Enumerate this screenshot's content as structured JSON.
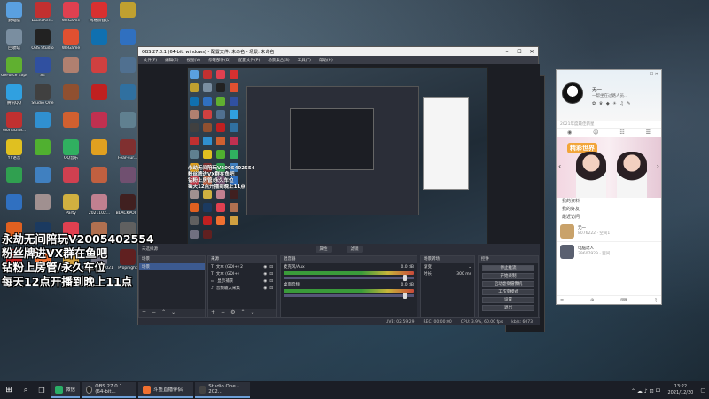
{
  "desktop": {
    "icons": [
      {
        "label": "此电脑",
        "color": "#5aa0e0"
      },
      {
        "label": "Launcher...",
        "color": "#c23030"
      },
      {
        "label": "WeGame",
        "color": "#e04050"
      },
      {
        "label": "网易云音乐",
        "color": "#d83030"
      },
      {
        "label": "",
        "color": "#c0a030"
      },
      {
        "label": "回收站",
        "color": "#7a8ea0"
      },
      {
        "label": "OBS Studio",
        "color": "#222"
      },
      {
        "label": "WeGame",
        "color": "#e05030"
      },
      {
        "label": "",
        "color": "#1070b0"
      },
      {
        "label": "",
        "color": "#3070c0"
      },
      {
        "label": "GeForce Experience",
        "color": "#60b030"
      },
      {
        "label": "SE",
        "color": "#3050a0"
      },
      {
        "label": "",
        "color": "#b08070"
      },
      {
        "label": "",
        "color": "#d04040"
      },
      {
        "label": "",
        "color": "#507090"
      },
      {
        "label": "腾讯QQ",
        "color": "#30a0e0"
      },
      {
        "label": "Studio One",
        "color": "#404040"
      },
      {
        "label": "",
        "color": "#905030"
      },
      {
        "label": "",
        "color": "#c02020"
      },
      {
        "label": "",
        "color": "#3070a0"
      },
      {
        "label": "WorldOfW...",
        "color": "#c03030"
      },
      {
        "label": "",
        "color": "#3090d0"
      },
      {
        "label": "",
        "color": "#d06030"
      },
      {
        "label": "",
        "color": "#c03050"
      },
      {
        "label": "",
        "color": "#608090"
      },
      {
        "label": "YY语音",
        "color": "#e0c020"
      },
      {
        "label": "",
        "color": "#50b030"
      },
      {
        "label": "QQ音乐",
        "color": "#30b060"
      },
      {
        "label": "",
        "color": "#e0a020"
      },
      {
        "label": "Fear-sur...",
        "color": "#803030"
      },
      {
        "label": "",
        "color": "#30a050"
      },
      {
        "label": "",
        "color": "#4080c0"
      },
      {
        "label": "",
        "color": "#d04050"
      },
      {
        "label": "",
        "color": "#c06040"
      },
      {
        "label": "",
        "color": "#705070"
      },
      {
        "label": "",
        "color": "#3070c0"
      },
      {
        "label": "",
        "color": "#a09090"
      },
      {
        "label": "Party",
        "color": "#d0b040"
      },
      {
        "label": "2021102...",
        "color": "#c08090"
      },
      {
        "label": "BLACKPOI...",
        "color": "#402020"
      },
      {
        "label": "向日葵",
        "color": "#e06020"
      },
      {
        "label": "Steam",
        "color": "#1b3a60"
      },
      {
        "label": "无畏伸缩",
        "color": "#e04050"
      },
      {
        "label": "Mahjong...",
        "color": "#b07050"
      },
      {
        "label": "",
        "color": "#606060"
      },
      {
        "label": "机箱助手",
        "color": "#c02020"
      },
      {
        "label": "斗鱼直播伴侣",
        "color": "#f07030"
      },
      {
        "label": "Counter-S... Global Off...",
        "color": "#d0a040"
      },
      {
        "label": "微信图片 2021122...",
        "color": "#707080"
      },
      {
        "label": "Propnight",
        "color": "#602020"
      }
    ],
    "overlay_lines": [
      "永劫无间陪玩V2005402554",
      "粉丝牌进VX群在鱼吧",
      "钻粉上房管/永久车位",
      "每天12点开播到晚上11点"
    ]
  },
  "obs": {
    "title": "OBS 27.0.1 (64-bit, windows) - 配置文件: 未命名 - 场景: 未命名",
    "controls": [
      "–",
      "☐",
      "✕"
    ],
    "menu": [
      "文件(F)",
      "编辑(E)",
      "视图(V)",
      "停靠部件(D)",
      "配置文件(P)",
      "场景集合(S)",
      "工具(T)",
      "帮助(H)"
    ],
    "mini_text": [
      "永劫无间陪玩V2005402554",
      "粉丝牌进VX群在鱼吧",
      "钻粉上房管/永久车位",
      "每天12点开播到晚上11点"
    ],
    "tabs": [
      "未选择源",
      "属性",
      "滤镜"
    ],
    "docks": {
      "scenes": {
        "header": "场景",
        "items": [
          "场景"
        ]
      },
      "sources": {
        "header": "来源",
        "items": [
          "文本 (GDI+) 2",
          "文本 (GDI+)",
          "显示捕获",
          "音频输入采集"
        ]
      },
      "mixer": {
        "header": "混音器",
        "items": [
          {
            "name": "麦克风/Aux",
            "db": "0.0 dB"
          },
          {
            "name": "桌面音频",
            "db": "0.0 dB"
          }
        ]
      },
      "transitions": {
        "header": "场景转场",
        "type": "渐变",
        "duration_label": "时长",
        "duration": "300 ms"
      },
      "controls": {
        "header": "控件",
        "buttons": [
          "停止推流",
          "开始录制",
          "启动虚拟摄像机",
          "工作室模式",
          "设置",
          "退出"
        ]
      }
    },
    "status": {
      "live": "LIVE: 02:59:29",
      "rec": "REC: 00:00:00",
      "cpu": "CPU: 3.9%, 60.00 fps",
      "kbs": "kb/s: 6073"
    }
  },
  "chat": {
    "controls": "—  ☐  ✕",
    "name": "无一",
    "signature": "一帮坐在过路人员...",
    "status_icons": "✿ ♛ ◆ ☀ ♫ ✎",
    "search": "2021年度最佳新星",
    "nav": [
      "◉",
      "☺",
      "☷",
      "☰"
    ],
    "banner_title": "精彩世界",
    "list": [
      "我的资料",
      "我的好友",
      "最近访问"
    ],
    "contacts": [
      {
        "name": "无一",
        "sub": "8076222 · 空间1"
      },
      {
        "name": "电脑達人",
        "sub": "39607929 · 空间"
      }
    ],
    "bottom": [
      "≡",
      "⊕",
      "⌨",
      "♫"
    ]
  },
  "taskbar": {
    "start": "⊞",
    "apps": [
      {
        "label": "微信",
        "color": "#2aae67"
      },
      {
        "label": "OBS 27.0.1 (64-bit...",
        "color": "#222"
      },
      {
        "label": "斗鱼直播伴侣",
        "color": "#f07030"
      },
      {
        "label": "Studio One - 202...",
        "color": "#444"
      }
    ],
    "tray": "⌃  ☁  ♪  ⊡  中",
    "time": "13:22",
    "date": "2021/12/30"
  }
}
